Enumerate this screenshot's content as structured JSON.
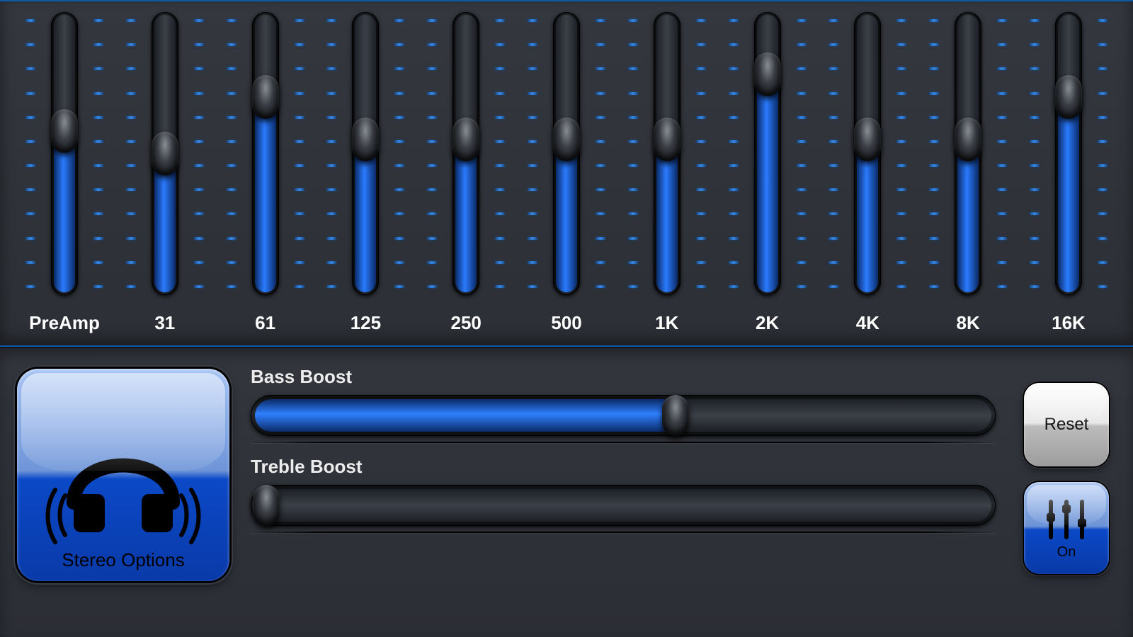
{
  "equalizer": {
    "bands": [
      {
        "label": "PreAmp",
        "value": 0.58
      },
      {
        "label": "31",
        "value": 0.5
      },
      {
        "label": "61",
        "value": 0.7
      },
      {
        "label": "125",
        "value": 0.55
      },
      {
        "label": "250",
        "value": 0.55
      },
      {
        "label": "500",
        "value": 0.55
      },
      {
        "label": "1K",
        "value": 0.55
      },
      {
        "label": "2K",
        "value": 0.78
      },
      {
        "label": "4K",
        "value": 0.55
      },
      {
        "label": "8K",
        "value": 0.55
      },
      {
        "label": "16K",
        "value": 0.7
      }
    ]
  },
  "stereo": {
    "label": "Stereo Options"
  },
  "boosts": {
    "bass": {
      "label": "Bass Boost",
      "value": 0.57
    },
    "treble": {
      "label": "Treble Boost",
      "value": 0.02
    }
  },
  "buttons": {
    "reset": "Reset",
    "on": "On"
  },
  "colors": {
    "accent": "#2a7bff",
    "panel_border": "#0a5aa8"
  }
}
